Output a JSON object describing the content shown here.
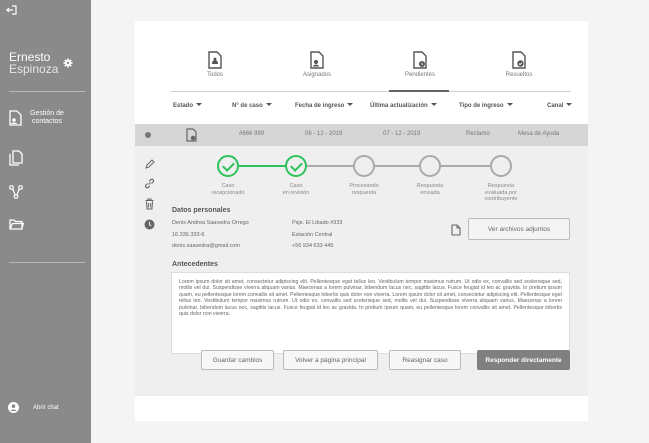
{
  "sidebar": {
    "user_first": "Ernesto",
    "user_last": "Espinoza",
    "contacts_label_1": "Gestión de",
    "contacts_label_2": "contactos",
    "chat_label": "Abrir chat"
  },
  "tabs": [
    {
      "label": "Todos",
      "icon": "all-documents-icon"
    },
    {
      "label": "Asignados",
      "icon": "assigned-documents-icon"
    },
    {
      "label": "Pendientes",
      "icon": "pending-documents-icon"
    },
    {
      "label": "Resueltos",
      "icon": "resolved-documents-icon"
    }
  ],
  "active_tab": "Pendientes",
  "columns": [
    "Estado",
    "N° de caso",
    "Fecha de ingreso",
    "Última actualización",
    "Tipo de ingreso",
    "Canal"
  ],
  "row": {
    "case_number": "#666 999",
    "intake_date": "06 - 12 - 2019",
    "updated": "07 - 12 - 2019",
    "type": "Reclamo",
    "channel": "Mesa de Ayuda"
  },
  "stepper": {
    "steps": [
      {
        "l1": "Caso",
        "l2": "recepcionado",
        "l3": "",
        "done": true
      },
      {
        "l1": "Caso",
        "l2": "en revisión",
        "l3": "",
        "done": true
      },
      {
        "l1": "Procesando",
        "l2": "respuesta",
        "l3": "",
        "done": false
      },
      {
        "l1": "Respuesta",
        "l2": "enviada",
        "l3": "",
        "done": false
      },
      {
        "l1": "Respuesta",
        "l2": "evaluada por",
        "l3": "contribuyente",
        "done": false
      }
    ],
    "done_color": "#2fc25a",
    "pending_color": "#aaaaaa"
  },
  "personal": {
    "title": "Datos personales",
    "name": "Denis Andrea Saavedra Orrego",
    "rut": "16.336.333-6",
    "email": "denis.saavedra@gmail.com",
    "address": "Psje. El Libado #333",
    "station": "Estación Central",
    "phone": "+56 934 633 445"
  },
  "attach_button": "Ver archivos adjuntos",
  "antecedentes": {
    "title": "Antecedentes",
    "text": "Lorem ipsum dolor sit amet, consectetur adipiscing elit. Pellentesque eget tellus leo. Vestibulum tempor maximus rutrum. Ut odio ex, convallis sed scelerisque sed, mollis vel dui. Suspendisse viverra aliquam varius. Maecenas a lorem pulvinar, bibendum lacus nec, sagittis lacus. Fusce feugiat id leo ac gravida. In pretium ipsum quam, eu pellentesque lorem convallis sit amet. Pellentesque lobortis quis dolor non viverra. Lorem ipsum dolor sit amet, consectetur adipiscing elit. Pellentesque eget tellus leo. Vestibulum tempor maximus rutrum. Ut odio ex, convallis sed scelerisque sed, mollis vel dui. Suspendisse viverra aliquam varius. Maecenas a lorem pulvinar, bibendum lacus nec, sagittis lacus. Fusce feugiat id leo ac gravida. In pretium ipsum quam, eu pellentesque lorem convallis sit amet. Pellentesque lobortis quis dolor non viverra."
  },
  "actions": {
    "save": "Guardar cambios",
    "back": "Volver a página principal",
    "reassign": "Reasignar caso",
    "reply": "Responder directamente"
  }
}
